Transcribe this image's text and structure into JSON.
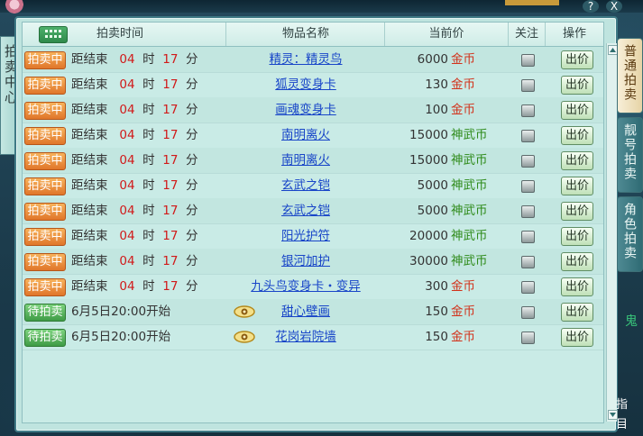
{
  "window": {
    "side_tab_left": "拍卖中心",
    "help_label": "?",
    "close_label": "X"
  },
  "right_tabs": [
    {
      "label": "普通拍卖",
      "selected": true
    },
    {
      "label": "靓号拍卖",
      "selected": false
    },
    {
      "label": "角色拍卖",
      "selected": false
    }
  ],
  "right_side_text": {
    "char_a": "鬼",
    "label_b": "指",
    "label_c": "目"
  },
  "table": {
    "headers": {
      "auction_time": "拍卖时间",
      "item_name": "物品名称",
      "current_price": "当前价",
      "watch": "关注",
      "action": "操作"
    },
    "bid_label": "出价",
    "rows": [
      {
        "status": "拍卖中",
        "status_type": "active",
        "time_prefix": "距结束",
        "hours": "04",
        "h_unit": "时",
        "minutes": "17",
        "m_unit": "分",
        "item": "精灵：精灵鸟",
        "price": "6000",
        "currency": "金币",
        "currency_type": "gold"
      },
      {
        "status": "拍卖中",
        "status_type": "active",
        "time_prefix": "距结束",
        "hours": "04",
        "h_unit": "时",
        "minutes": "17",
        "m_unit": "分",
        "item": "狐灵变身卡",
        "price": "130",
        "currency": "金币",
        "currency_type": "gold"
      },
      {
        "status": "拍卖中",
        "status_type": "active",
        "time_prefix": "距结束",
        "hours": "04",
        "h_unit": "时",
        "minutes": "17",
        "m_unit": "分",
        "item": "画魂变身卡",
        "price": "100",
        "currency": "金币",
        "currency_type": "gold"
      },
      {
        "status": "拍卖中",
        "status_type": "active",
        "time_prefix": "距结束",
        "hours": "04",
        "h_unit": "时",
        "minutes": "17",
        "m_unit": "分",
        "item": "南明离火",
        "price": "15000",
        "currency": "神武币",
        "currency_type": "shenwu"
      },
      {
        "status": "拍卖中",
        "status_type": "active",
        "time_prefix": "距结束",
        "hours": "04",
        "h_unit": "时",
        "minutes": "17",
        "m_unit": "分",
        "item": "南明离火",
        "price": "15000",
        "currency": "神武币",
        "currency_type": "shenwu"
      },
      {
        "status": "拍卖中",
        "status_type": "active",
        "time_prefix": "距结束",
        "hours": "04",
        "h_unit": "时",
        "minutes": "17",
        "m_unit": "分",
        "item": "玄武之铠",
        "price": "5000",
        "currency": "神武币",
        "currency_type": "shenwu"
      },
      {
        "status": "拍卖中",
        "status_type": "active",
        "time_prefix": "距结束",
        "hours": "04",
        "h_unit": "时",
        "minutes": "17",
        "m_unit": "分",
        "item": "玄武之铠",
        "price": "5000",
        "currency": "神武币",
        "currency_type": "shenwu"
      },
      {
        "status": "拍卖中",
        "status_type": "active",
        "time_prefix": "距结束",
        "hours": "04",
        "h_unit": "时",
        "minutes": "17",
        "m_unit": "分",
        "item": "阳光护符",
        "price": "20000",
        "currency": "神武币",
        "currency_type": "shenwu"
      },
      {
        "status": "拍卖中",
        "status_type": "active",
        "time_prefix": "距结束",
        "hours": "04",
        "h_unit": "时",
        "minutes": "17",
        "m_unit": "分",
        "item": "银河加护",
        "price": "30000",
        "currency": "神武币",
        "currency_type": "shenwu"
      },
      {
        "status": "拍卖中",
        "status_type": "active",
        "time_prefix": "距结束",
        "hours": "04",
        "h_unit": "时",
        "minutes": "17",
        "m_unit": "分",
        "item": "九头鸟变身卡・变异",
        "price": "300",
        "currency": "金币",
        "currency_type": "gold"
      },
      {
        "status": "待拍卖",
        "status_type": "pending",
        "start_text": "6月5日20:00开始",
        "has_preview": true,
        "item": "甜心壁画",
        "price": "150",
        "currency": "金币",
        "currency_type": "gold"
      },
      {
        "status": "待拍卖",
        "status_type": "pending",
        "start_text": "6月5日20:00开始",
        "has_preview": true,
        "item": "花岗岩院墙",
        "price": "150",
        "currency": "金币",
        "currency_type": "gold"
      }
    ]
  },
  "colors": {
    "gold_currency": "#d2321b",
    "shenwu_currency": "#2d8a18",
    "item_link": "#1845c8",
    "countdown_number": "#d11a1a"
  }
}
